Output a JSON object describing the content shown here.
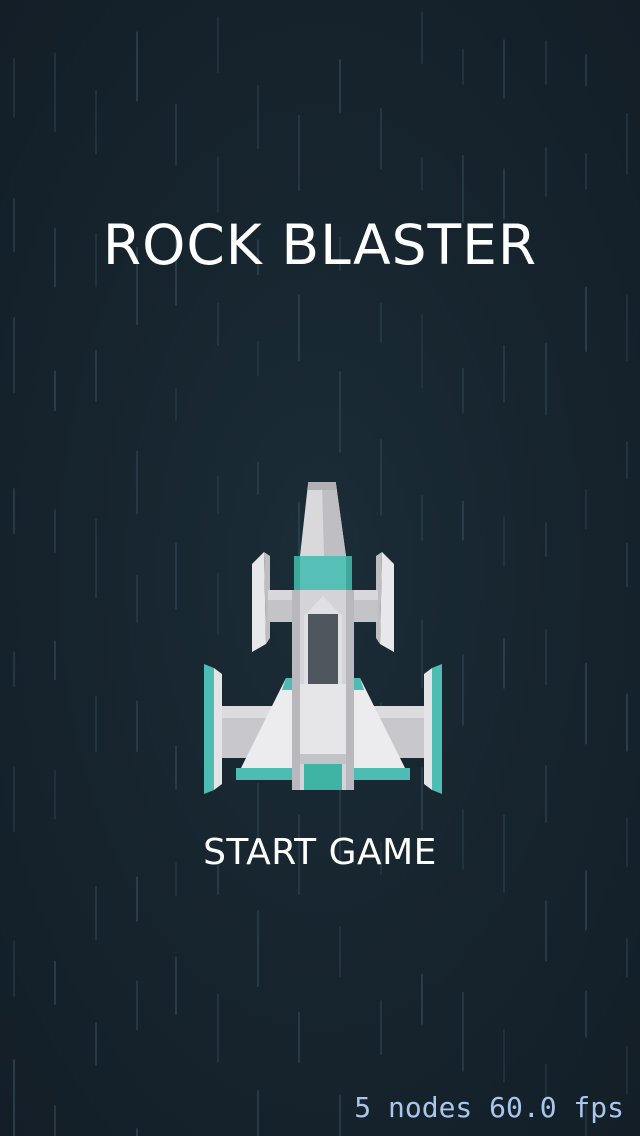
{
  "game": {
    "title": "ROCK BLASTER",
    "start_label": "START GAME"
  },
  "debug_overlay": {
    "text": "5 nodes 60.0 fps"
  },
  "player_ship": {
    "icon": "spaceship-icon"
  },
  "colors": {
    "background": "#17252f",
    "title_text": "#ffffff",
    "debug_text": "#a9c6ec",
    "ship_accent": "#4dbdb3",
    "ship_hull": "#e6e6e6"
  }
}
